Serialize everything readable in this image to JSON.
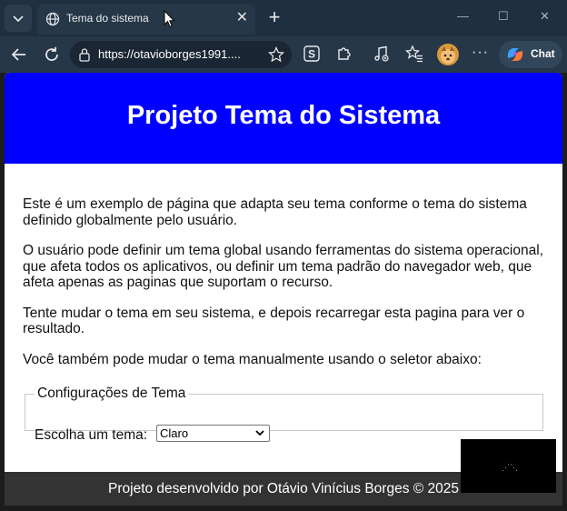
{
  "browser": {
    "tab": {
      "title": "Tema do sistema"
    },
    "address_bar": {
      "url": "https://otavioborges1991...."
    },
    "chat_button": {
      "label": "Chat"
    },
    "more_label": "···",
    "icons": [
      "tab-list-icon",
      "globe-icon",
      "close-icon",
      "plus-icon",
      "minimize-icon",
      "maximize-icon",
      "back-icon",
      "refresh-icon",
      "lock-icon",
      "star-icon",
      "extension-s-icon",
      "puzzle-icon",
      "music-icon",
      "favorites-icon",
      "avatar-icon",
      "copilot-icon"
    ],
    "colors": {
      "tabbar": "#1f2f3f",
      "toolbar": "#263748",
      "active_tab": "#263748"
    }
  },
  "page": {
    "header": {
      "title": "Projeto Tema do Sistema",
      "background": "#0000ff"
    },
    "paragraphs": [
      "Este é um exemplo de página que adapta seu tema conforme o tema do sistema definido globalmente pelo usuário.",
      "O usuário pode definir um tema global usando ferramentas do sistema operacional, que afeta todos os aplicativos, ou definir um tema padrão do navegador web, que afeta apenas as paginas que suportam o recurso.",
      "Tente mudar o tema em seu sistema, e depois recarregar esta pagina para ver o resultado.",
      "Você também pode mudar o tema manualmente usando o seletor abaixo:"
    ],
    "settings": {
      "legend": "Configurações de Tema",
      "choose_label": "Escolha um tema:",
      "selected_theme": "Claro"
    },
    "footer": {
      "text": "Projeto desenvolvido por Otávio Vinícius Borges © 2025",
      "background": "#333333"
    }
  }
}
